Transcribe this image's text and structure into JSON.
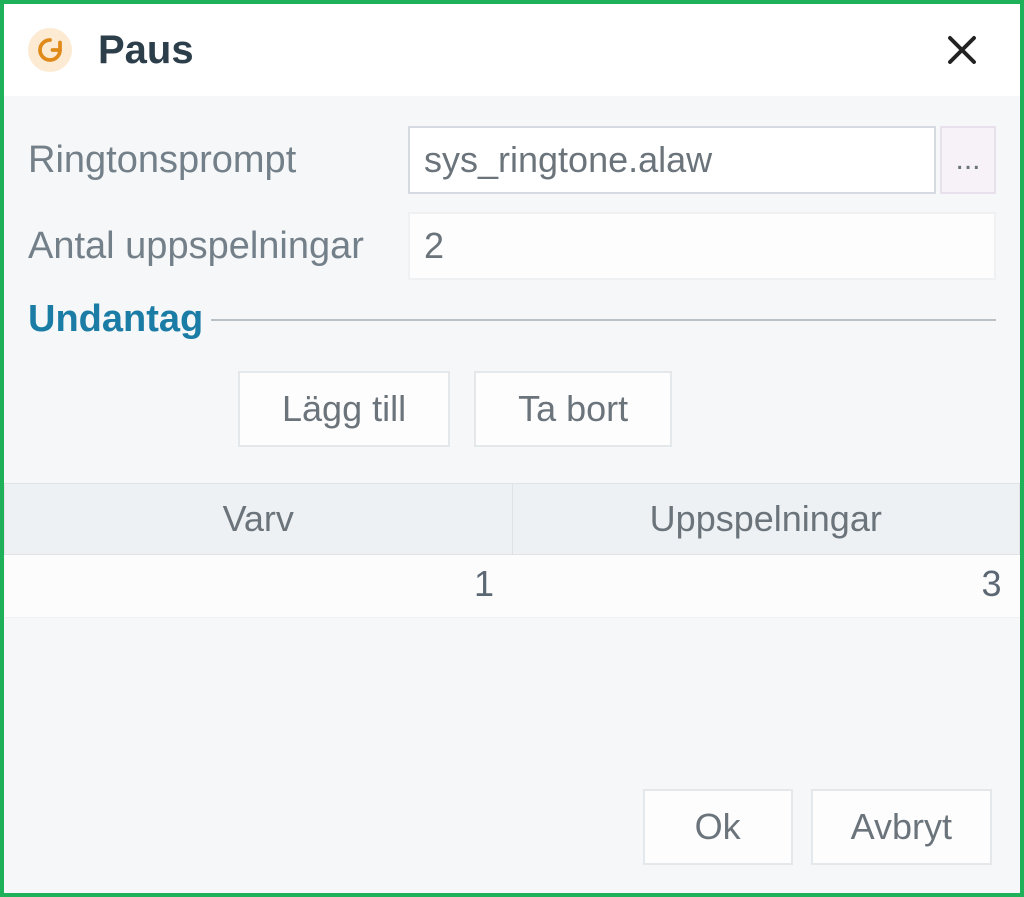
{
  "dialog": {
    "title": "Paus"
  },
  "form": {
    "ringtone_label": "Ringtonsprompt",
    "ringtone_value": "sys_ringtone.alaw",
    "browse_label": "...",
    "plays_label": "Antal uppspelningar",
    "plays_value": "2"
  },
  "exceptions": {
    "section_title": "Undantag",
    "add_label": "Lägg till",
    "remove_label": "Ta bort",
    "col_lap": "Varv",
    "col_plays": "Uppspelningar",
    "rows": [
      {
        "lap": "1",
        "plays": "3"
      }
    ]
  },
  "footer": {
    "ok_label": "Ok",
    "cancel_label": "Avbryt"
  }
}
